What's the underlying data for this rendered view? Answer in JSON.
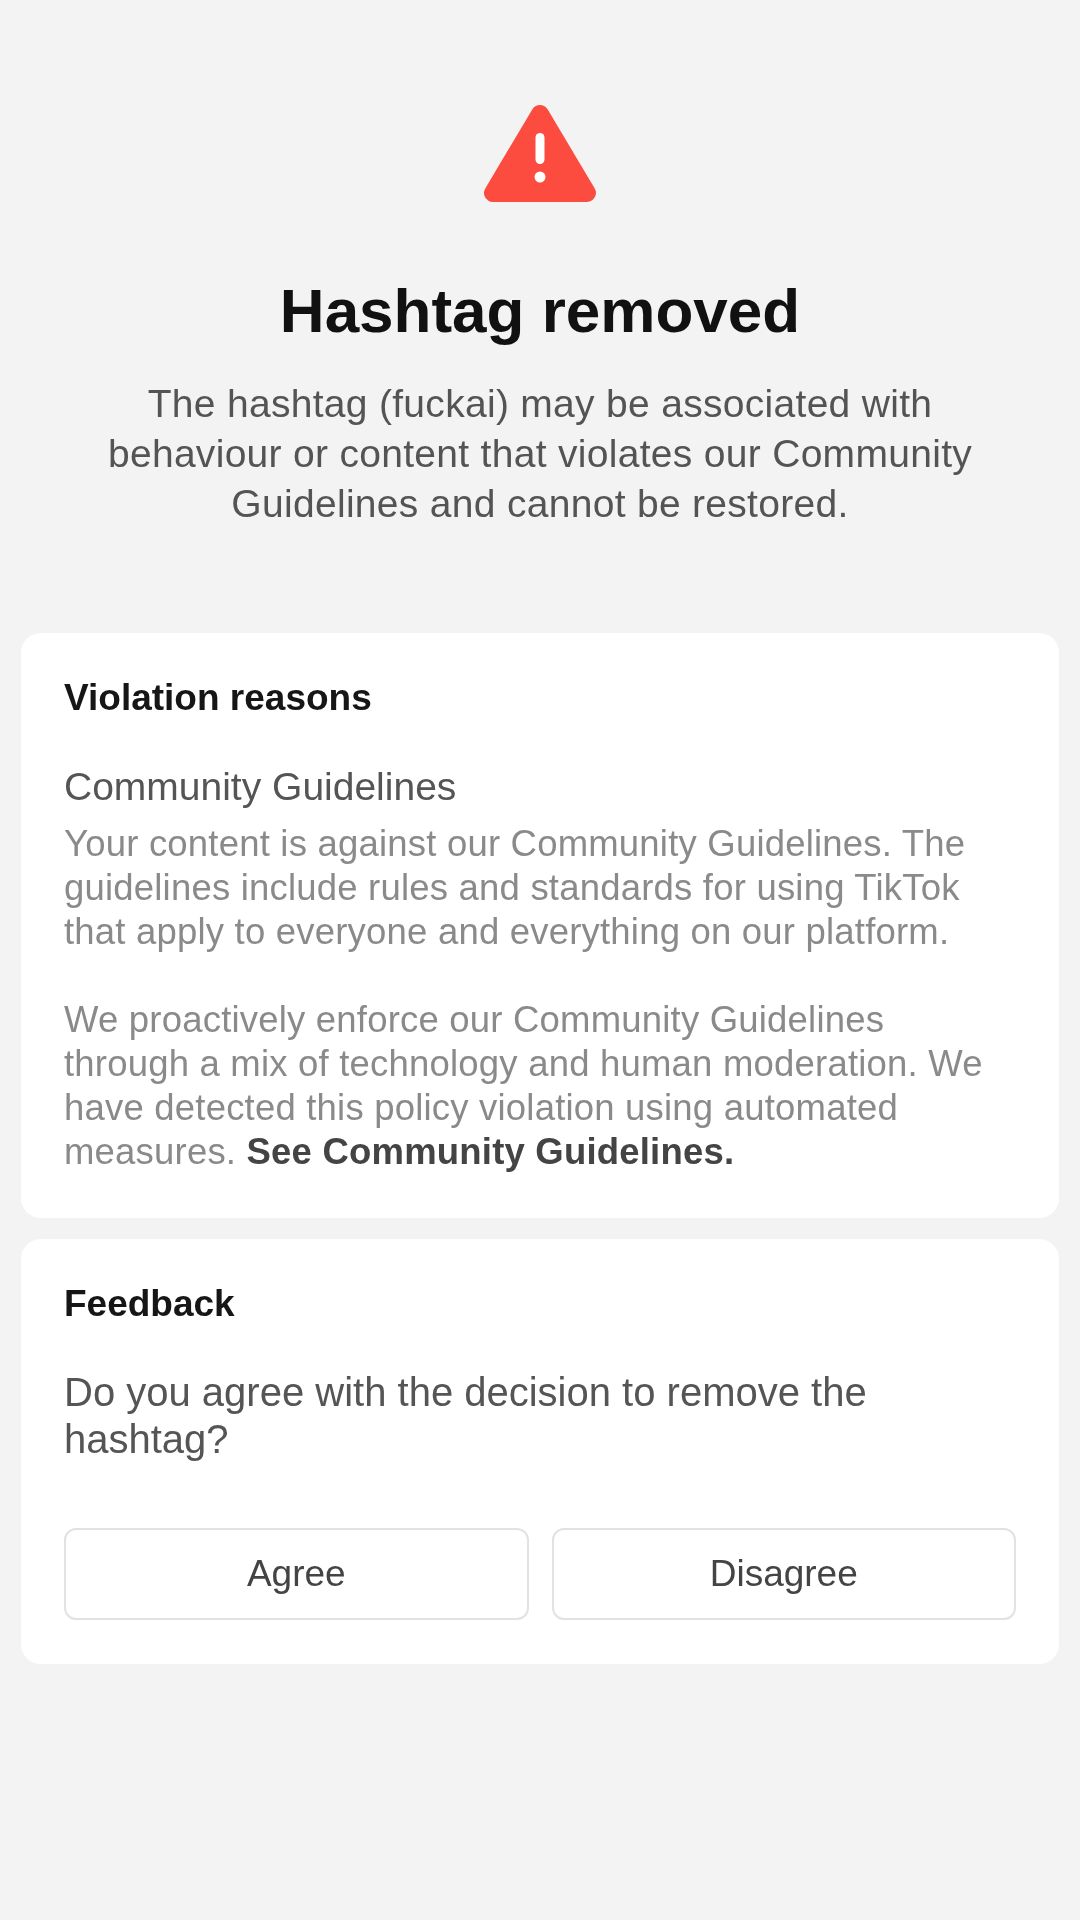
{
  "alert": {
    "title": "Hashtag removed",
    "message": "The hashtag (fuckai) may be associated with behaviour or content that violates our Community Guidelines and cannot be restored."
  },
  "violation_card": {
    "heading": "Violation reasons",
    "reason": {
      "title": "Community Guidelines",
      "paragraphs": [
        {
          "text": "Your content is against our Community Guidelines. The guidelines include rules and standards for using TikTok that apply to everyone and everything on our platform."
        },
        {
          "text": "We proactively enforce our Community Guidelines through a mix of technology and human moderation. We have detected this policy violation using automated measures.",
          "link": "See Community Guidelines."
        }
      ]
    }
  },
  "feedback_card": {
    "heading": "Feedback",
    "question": "Do you agree with the decision to remove the hashtag?",
    "buttons": [
      "Agree",
      "Disagree"
    ]
  }
}
